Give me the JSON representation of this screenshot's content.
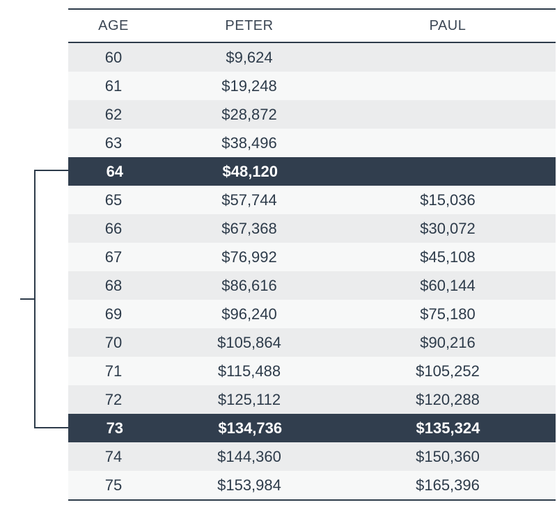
{
  "columns": {
    "age": "AGE",
    "peter": "PETER",
    "paul": "PAUL"
  },
  "highlight_indices": [
    4,
    13
  ],
  "rows": [
    {
      "age": "60",
      "peter": "$9,624",
      "paul": ""
    },
    {
      "age": "61",
      "peter": "$19,248",
      "paul": ""
    },
    {
      "age": "62",
      "peter": "$28,872",
      "paul": ""
    },
    {
      "age": "63",
      "peter": "$38,496",
      "paul": ""
    },
    {
      "age": "64",
      "peter": "$48,120",
      "paul": ""
    },
    {
      "age": "65",
      "peter": "$57,744",
      "paul": "$15,036"
    },
    {
      "age": "66",
      "peter": "$67,368",
      "paul": "$30,072"
    },
    {
      "age": "67",
      "peter": "$76,992",
      "paul": "$45,108"
    },
    {
      "age": "68",
      "peter": "$86,616",
      "paul": "$60,144"
    },
    {
      "age": "69",
      "peter": "$96,240",
      "paul": "$75,180"
    },
    {
      "age": "70",
      "peter": "$105,864",
      "paul": "$90,216"
    },
    {
      "age": "71",
      "peter": "$115,488",
      "paul": "$105,252"
    },
    {
      "age": "72",
      "peter": "$125,112",
      "paul": "$120,288"
    },
    {
      "age": "73",
      "peter": "$134,736",
      "paul": "$135,324"
    },
    {
      "age": "74",
      "peter": "$144,360",
      "paul": "$150,360"
    },
    {
      "age": "75",
      "peter": "$153,984",
      "paul": "$165,396"
    }
  ],
  "chart_data": {
    "type": "table",
    "title": "",
    "columns": [
      "AGE",
      "PETER",
      "PAUL"
    ],
    "rows": [
      [
        60,
        9624,
        null
      ],
      [
        61,
        19248,
        null
      ],
      [
        62,
        28872,
        null
      ],
      [
        63,
        38496,
        null
      ],
      [
        64,
        48120,
        null
      ],
      [
        65,
        57744,
        15036
      ],
      [
        66,
        67368,
        30072
      ],
      [
        67,
        76992,
        45108
      ],
      [
        68,
        86616,
        60144
      ],
      [
        69,
        96240,
        75180
      ],
      [
        70,
        105864,
        90216
      ],
      [
        71,
        115488,
        105252
      ],
      [
        72,
        125112,
        120288
      ],
      [
        73,
        134736,
        135324
      ],
      [
        74,
        144360,
        150360
      ],
      [
        75,
        153984,
        165396
      ]
    ],
    "highlighted_rows_age": [
      64,
      73
    ]
  }
}
